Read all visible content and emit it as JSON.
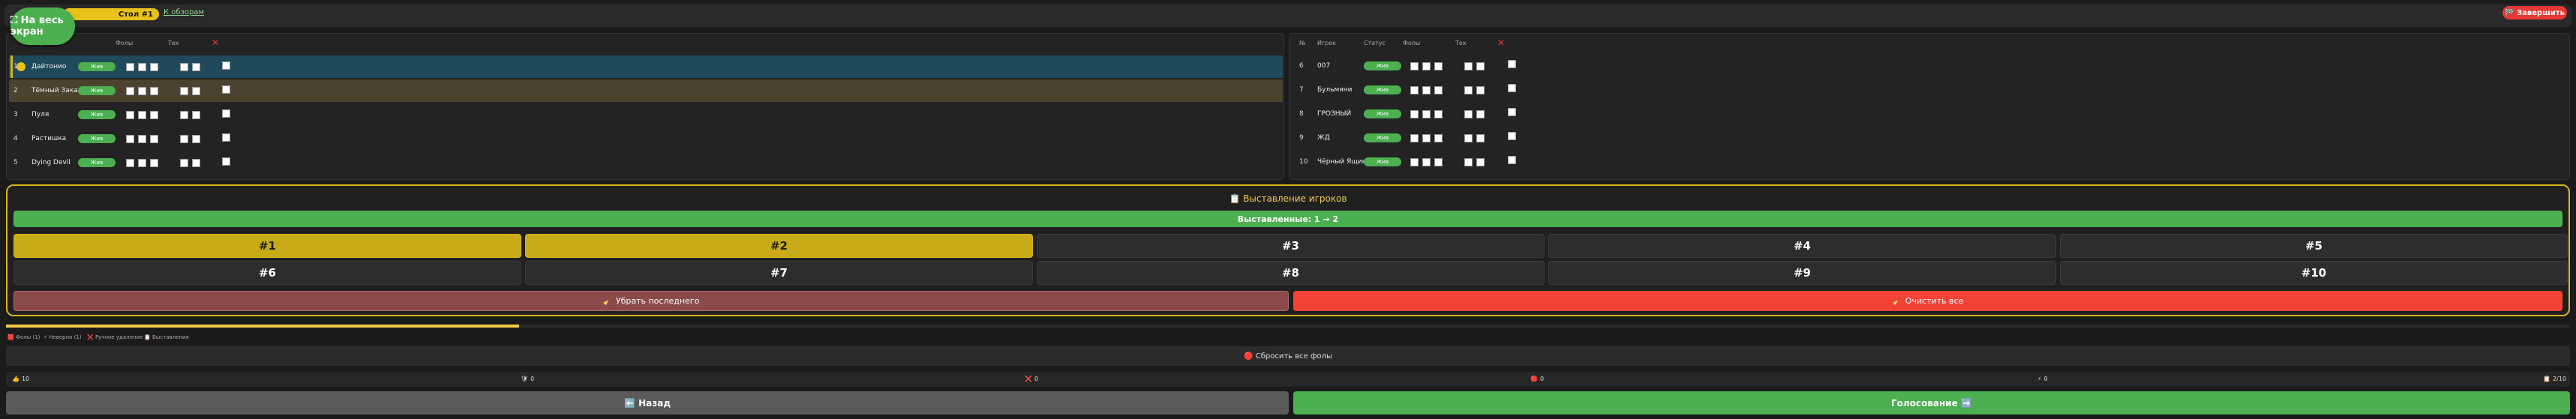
{
  "header": {
    "fullscreen_label": "⛶ На весь экран",
    "table_badge": "Стол #1",
    "overview_link": "К обзорам",
    "finish_label": "🏁 Завершить"
  },
  "left_table": {
    "columns": [
      "",
      "Игрок",
      "Фолы",
      "Тех",
      "✕"
    ],
    "rows": [
      {
        "num": "1",
        "name": "Дайтонио",
        "role": "Жив"
      },
      {
        "num": "2",
        "name": "Тёмный Заказ",
        "role": "Жив"
      },
      {
        "num": "3",
        "name": "Пуля",
        "role": "Жив"
      },
      {
        "num": "4",
        "name": "Растишка",
        "role": "Жив"
      },
      {
        "num": "5",
        "name": "Dying Devil",
        "role": "Жив"
      }
    ]
  },
  "right_table": {
    "columns": [
      "№",
      "Игрок",
      "Статус",
      "Фолы",
      "Тех",
      "✕"
    ],
    "rows": [
      {
        "num": "6",
        "name": "007",
        "role": "Жив"
      },
      {
        "num": "7",
        "name": "Бульмяни",
        "role": "Жив"
      },
      {
        "num": "8",
        "name": "ГРОЗНЫЙ",
        "role": "Жив"
      },
      {
        "num": "9",
        "name": "ЖД",
        "role": "Жив"
      },
      {
        "num": "10",
        "name": "Чёрный Ящик",
        "role": "Жив"
      }
    ]
  },
  "nomination": {
    "title": "📋 Выставление игроков",
    "nominated_label": "Выставленные: 1 → 2",
    "candidates": [
      "#1",
      "#2",
      "#3",
      "#4",
      "#5",
      "#6",
      "#7",
      "#8",
      "#9",
      "#10"
    ],
    "selected": [
      "#1",
      "#2"
    ],
    "remove_last_label": "🧹 Убрать последнего",
    "clear_all_label": "🧹 Очистить все"
  },
  "progress": {
    "fraction": 0.2
  },
  "legend": [
    "🟥 Фолы (1)",
    "⚡ Неверно (1)",
    "❌ Ручное удаление",
    "📋 Выставления"
  ],
  "reset_fouls_label": "🔴 Сбросить все фолы",
  "stats": [
    {
      "icon": "👍",
      "value": "10"
    },
    {
      "icon": "🛡",
      "value": "0"
    },
    {
      "icon": "❌",
      "value": "0"
    },
    {
      "icon": "🔴",
      "value": "0"
    },
    {
      "icon": "⚡",
      "value": "0"
    },
    {
      "icon": "📋",
      "value": "2/10"
    }
  ],
  "footer": {
    "back_label": "⬅️ Назад",
    "vote_label": "Голосование ➡️"
  },
  "colors": {
    "accent_green": "#4caf50",
    "accent_yellow": "#d9b51c",
    "danger_red": "#e53935"
  }
}
